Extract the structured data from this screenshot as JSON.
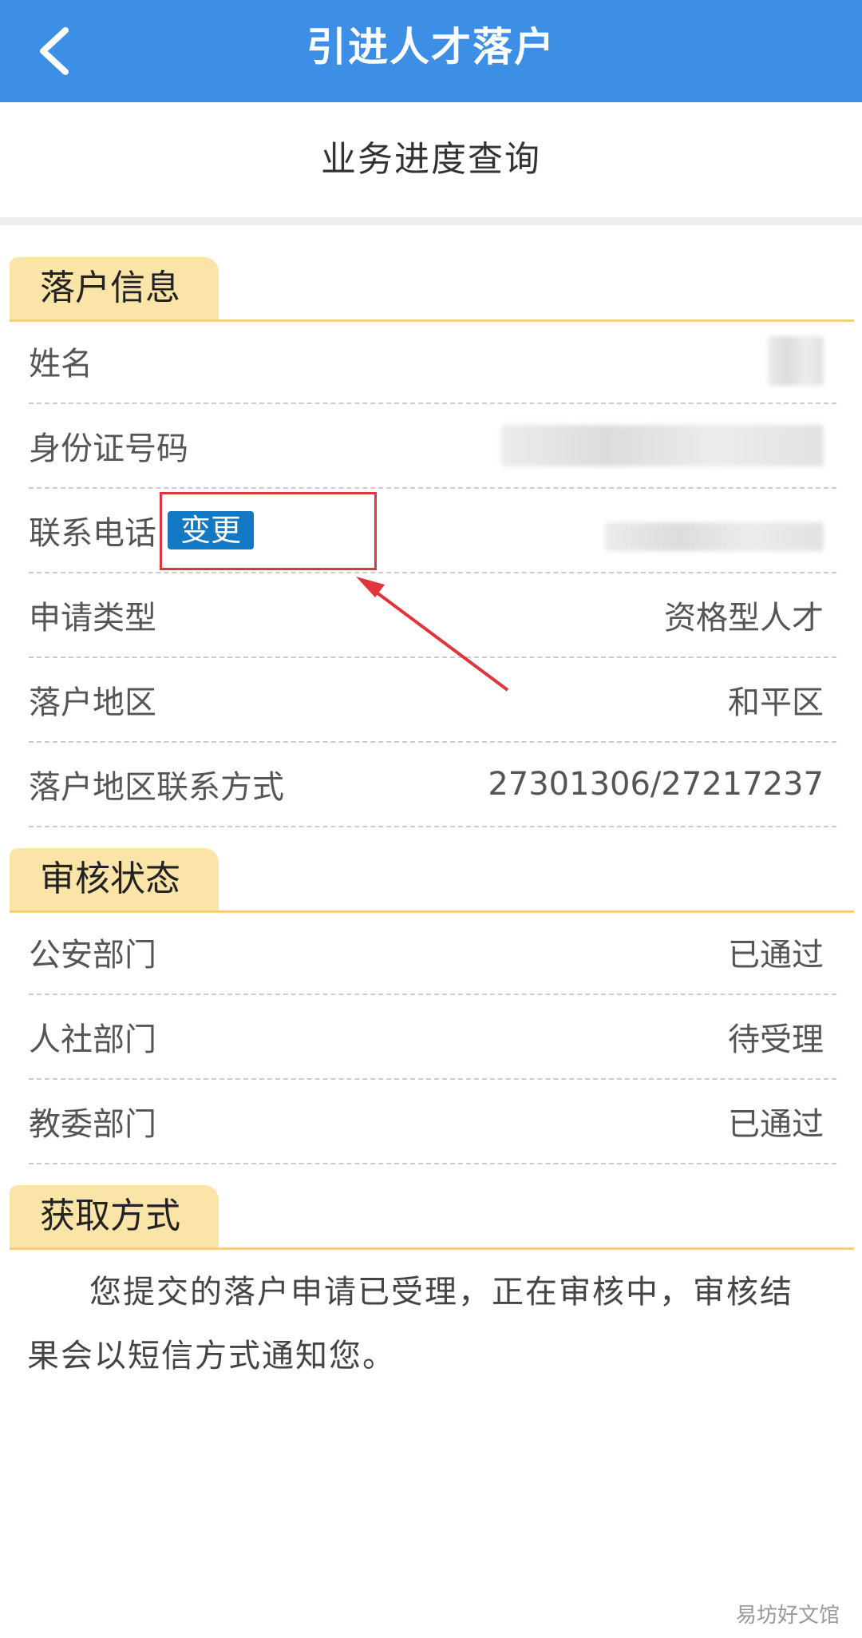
{
  "header": {
    "title": "引进人才落户",
    "back_icon": "chevron-left-icon"
  },
  "subtitle": "业务进度查询",
  "sections": {
    "settle_info": {
      "title": "落户信息",
      "rows": {
        "name": {
          "label": "姓名"
        },
        "id_number": {
          "label": "身份证号码"
        },
        "phone": {
          "label": "联系电话",
          "change_label": "变更"
        },
        "apply_type": {
          "label": "申请类型",
          "value": "资格型人才"
        },
        "district": {
          "label": "落户地区",
          "value": "和平区"
        },
        "district_contact": {
          "label": "落户地区联系方式",
          "value": "27301306/27217237"
        }
      }
    },
    "review_status": {
      "title": "审核状态",
      "rows": {
        "police": {
          "label": "公安部门",
          "value": "已通过"
        },
        "hr": {
          "label": "人社部门",
          "value": "待受理"
        },
        "education": {
          "label": "教委部门",
          "value": "已通过"
        }
      }
    },
    "retrieval": {
      "title": "获取方式",
      "notice": "您提交的落户申请已受理，正在审核中，审核结果会以短信方式通知您。"
    }
  },
  "watermark": "易坊好文馆",
  "colors": {
    "topbar": "#3d8ee5",
    "section_tab": "#fbe4a8",
    "change_button": "#1479c4",
    "highlight": "#e0353a"
  }
}
